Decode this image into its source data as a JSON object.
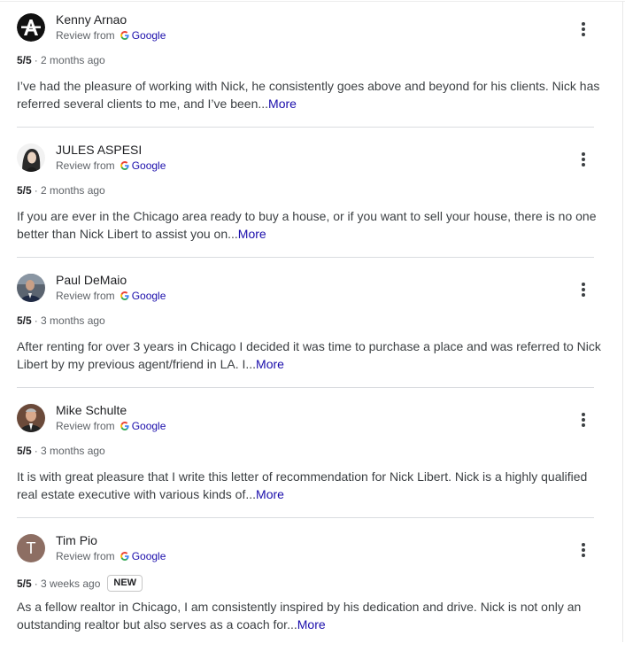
{
  "reviews": [
    {
      "name": "Kenny Arnao",
      "source_prefix": "Review from",
      "source_name": "Google",
      "rating": "5/5",
      "time": "· 2 months ago",
      "text": "I’ve had the pleasure of working with Nick, he consistently goes above and beyond for his clients. Nick has referred several clients to me, and I’ve been...",
      "more": "More",
      "avatar": "logo-a-icon"
    },
    {
      "name": "JULES ASPESI",
      "source_prefix": "Review from",
      "source_name": "Google",
      "rating": "5/5",
      "time": "· 2 months ago",
      "text": "If you are ever in the Chicago area ready to buy a house, or if you want to sell your house, there is no one better than Nick Libert to assist you on...",
      "more": "More",
      "avatar": "photo-portrait"
    },
    {
      "name": "Paul DeMaio",
      "source_prefix": "Review from",
      "source_name": "Google",
      "rating": "5/5",
      "time": "· 3 months ago",
      "text": "After renting for over 3 years in Chicago I decided it was time to purchase a place and was referred to Nick Libert by my previous agent/friend in LA. I...",
      "more": "More",
      "avatar": "photo-portrait"
    },
    {
      "name": "Mike Schulte",
      "source_prefix": "Review from",
      "source_name": "Google",
      "rating": "5/5",
      "time": "· 3 months ago",
      "text": "It is with great pleasure that I write this letter of recommendation for Nick Libert. Nick is a highly qualified real estate executive with various kinds of...",
      "more": "More",
      "avatar": "photo-portrait"
    },
    {
      "name": "Tim Pio",
      "source_prefix": "Review from",
      "source_name": "Google",
      "rating": "5/5",
      "time": "· 3 weeks ago",
      "badge": "NEW",
      "text": "As a fellow realtor in Chicago, I am consistently inspired by his dedication and drive. Nick is not only an outstanding realtor but also serves as a coach for...",
      "more": "More",
      "avatar_letter": "T"
    }
  ],
  "colors": {
    "link": "#1a0dab",
    "secondary_text": "#5f6368",
    "divider": "#dadce0",
    "avatar_letter_bg": "#8d6e63"
  }
}
